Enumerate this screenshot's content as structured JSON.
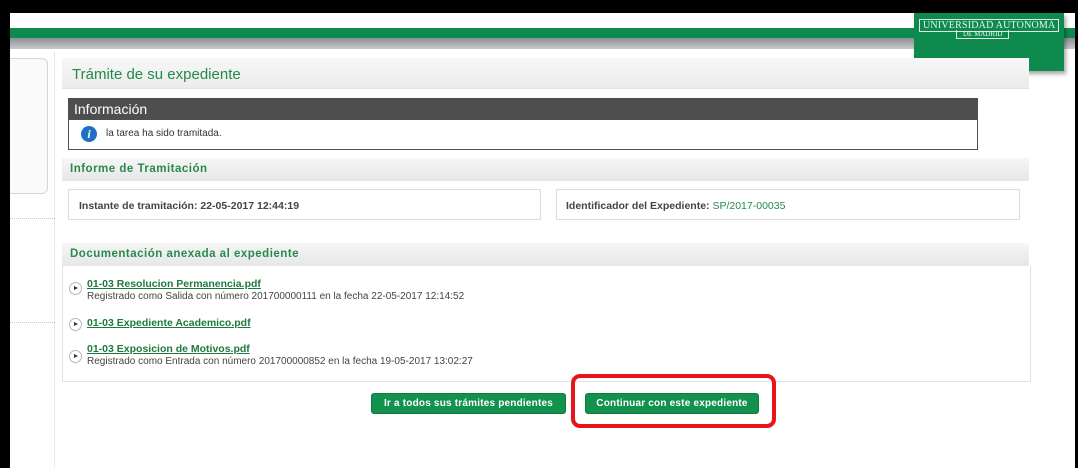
{
  "logo": {
    "line1": "UNIVERSIDAD  AUTONOMA",
    "line2": "DE MADRID"
  },
  "page": {
    "title": "Trámite de su expediente"
  },
  "info": {
    "heading": "Información",
    "message": "la tarea ha sido tramitada.",
    "icon": "info-icon"
  },
  "informe": {
    "heading": "Informe de Tramitación",
    "instante_label": "Instante de tramitación:",
    "instante_value": "22-05-2017 12:44:19",
    "identificador_label": "Identificador del Expediente:",
    "identificador_value": "SP/2017-00035"
  },
  "documentacion": {
    "heading": "Documentación anexada al expediente",
    "items": [
      {
        "name": "01-03 Resolucion Permanencia.pdf",
        "desc": "Registrado como Salida con número 201700000111 en la fecha 22-05-2017 12:14:52"
      },
      {
        "name": "01-03 Expediente Academico.pdf",
        "desc": ""
      },
      {
        "name": "01-03 Exposicion de Motivos.pdf",
        "desc": "Registrado como Entrada con número 201700000852 en la fecha 19-05-2017 13:02:27"
      }
    ]
  },
  "actions": {
    "pendientes_label": "Ir a todos sus trámites pendientes",
    "continuar_label": "Continuar con este expediente"
  },
  "colors": {
    "brand_green": "#0f8a4f",
    "highlight_red": "#e8141c",
    "info_blue": "#1f6fc5"
  }
}
